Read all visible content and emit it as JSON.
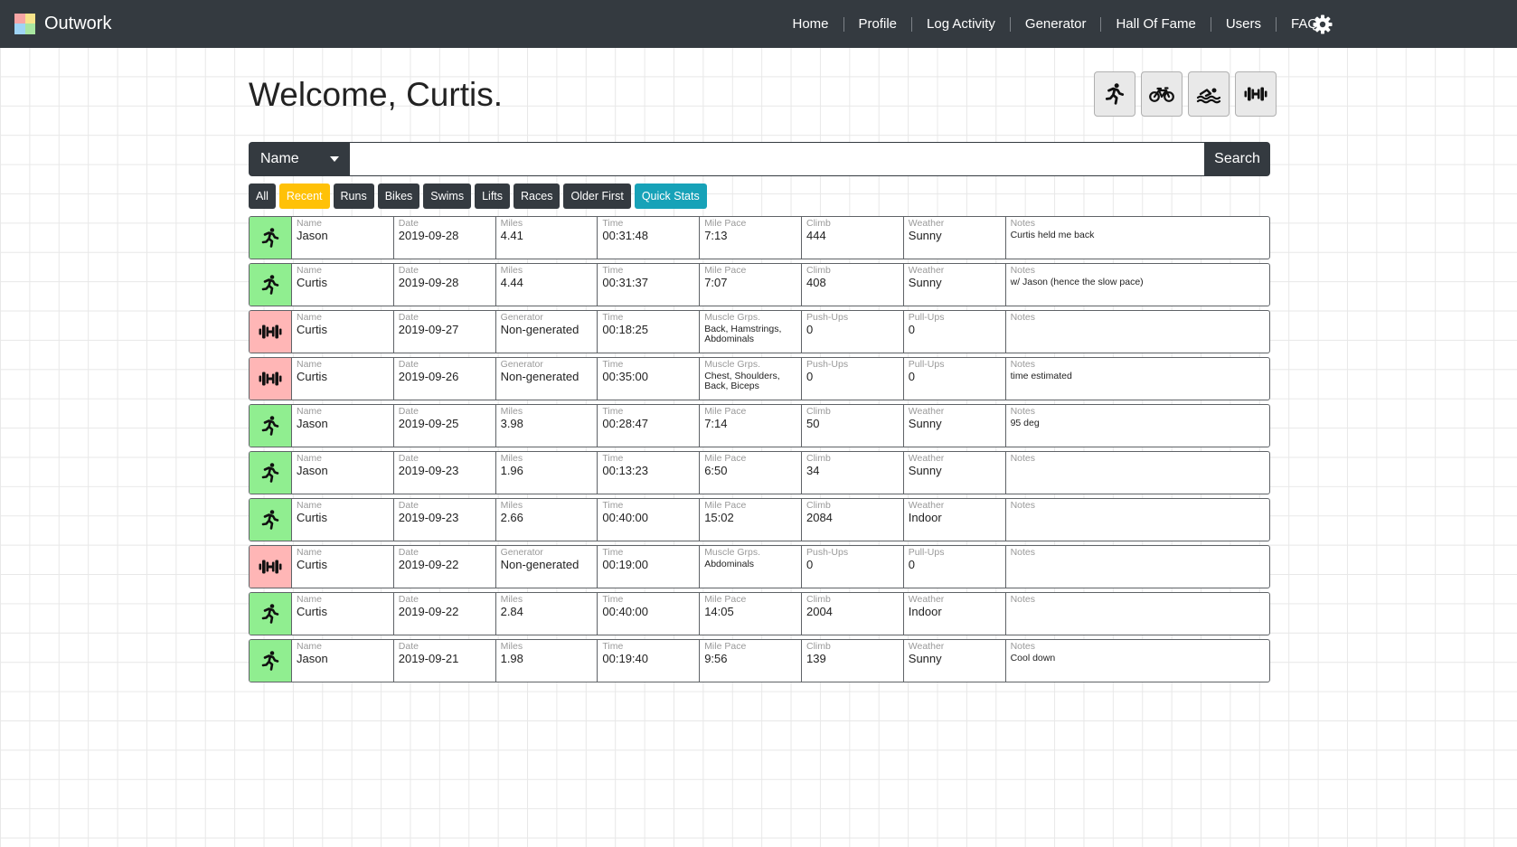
{
  "navbar": {
    "brand": "Outwork",
    "logo_colors": [
      "#f7a5a5",
      "#f7e38a",
      "#9fd4f5",
      "#a8e6a1"
    ],
    "links": [
      "Home",
      "Profile",
      "Log Activity",
      "Generator",
      "Hall Of Fame",
      "Users",
      "FAQ"
    ],
    "settings_icon": "gear-icon"
  },
  "welcome": "Welcome, Curtis.",
  "quick_actions": [
    "running-icon",
    "bike-icon",
    "swimming-icon",
    "dumbbell-icon"
  ],
  "search": {
    "dropdown_value": "Name",
    "input_value": "",
    "button": "Search"
  },
  "filters": [
    "All",
    "Recent",
    "Runs",
    "Bikes",
    "Swims",
    "Lifts",
    "Races",
    "Older First",
    "Quick Stats"
  ],
  "active_filter": "Recent",
  "colors": {
    "run": "#90ee90",
    "lift": "#ffb6b6",
    "dark": "#343a40",
    "recent": "#ffc107",
    "quick_stats": "#17a2b8"
  },
  "activities": [
    {
      "type": "run",
      "cells": [
        [
          "Name",
          "Jason"
        ],
        [
          "Date",
          "2019-09-28"
        ],
        [
          "Miles",
          "4.41"
        ],
        [
          "Time",
          "00:31:48"
        ],
        [
          "Mile Pace",
          "7:13"
        ],
        [
          "Climb",
          "444"
        ],
        [
          "Weather",
          "Sunny"
        ],
        [
          "Notes",
          "Curtis held me back"
        ]
      ]
    },
    {
      "type": "run",
      "cells": [
        [
          "Name",
          "Curtis"
        ],
        [
          "Date",
          "2019-09-28"
        ],
        [
          "Miles",
          "4.44"
        ],
        [
          "Time",
          "00:31:37"
        ],
        [
          "Mile Pace",
          "7:07"
        ],
        [
          "Climb",
          "408"
        ],
        [
          "Weather",
          "Sunny"
        ],
        [
          "Notes",
          "w/ Jason (hence the slow pace)"
        ]
      ]
    },
    {
      "type": "lift",
      "cells": [
        [
          "Name",
          "Curtis"
        ],
        [
          "Date",
          "2019-09-27"
        ],
        [
          "Generator",
          "Non-generated"
        ],
        [
          "Time",
          "00:18:25"
        ],
        [
          "Muscle Grps.",
          "Back, Hamstrings, Abdominals"
        ],
        [
          "Push-Ups",
          "0"
        ],
        [
          "Pull-Ups",
          "0"
        ],
        [
          "Notes",
          ""
        ]
      ]
    },
    {
      "type": "lift",
      "cells": [
        [
          "Name",
          "Curtis"
        ],
        [
          "Date",
          "2019-09-26"
        ],
        [
          "Generator",
          "Non-generated"
        ],
        [
          "Time",
          "00:35:00"
        ],
        [
          "Muscle Grps.",
          "Chest, Shoulders, Back, Biceps"
        ],
        [
          "Push-Ups",
          "0"
        ],
        [
          "Pull-Ups",
          "0"
        ],
        [
          "Notes",
          "time estimated"
        ]
      ]
    },
    {
      "type": "run",
      "cells": [
        [
          "Name",
          "Jason"
        ],
        [
          "Date",
          "2019-09-25"
        ],
        [
          "Miles",
          "3.98"
        ],
        [
          "Time",
          "00:28:47"
        ],
        [
          "Mile Pace",
          "7:14"
        ],
        [
          "Climb",
          "50"
        ],
        [
          "Weather",
          "Sunny"
        ],
        [
          "Notes",
          "95 deg"
        ]
      ]
    },
    {
      "type": "run",
      "cells": [
        [
          "Name",
          "Jason"
        ],
        [
          "Date",
          "2019-09-23"
        ],
        [
          "Miles",
          "1.96"
        ],
        [
          "Time",
          "00:13:23"
        ],
        [
          "Mile Pace",
          "6:50"
        ],
        [
          "Climb",
          "34"
        ],
        [
          "Weather",
          "Sunny"
        ],
        [
          "Notes",
          ""
        ]
      ]
    },
    {
      "type": "run",
      "cells": [
        [
          "Name",
          "Curtis"
        ],
        [
          "Date",
          "2019-09-23"
        ],
        [
          "Miles",
          "2.66"
        ],
        [
          "Time",
          "00:40:00"
        ],
        [
          "Mile Pace",
          "15:02"
        ],
        [
          "Climb",
          "2084"
        ],
        [
          "Weather",
          "Indoor"
        ],
        [
          "Notes",
          ""
        ]
      ]
    },
    {
      "type": "lift",
      "cells": [
        [
          "Name",
          "Curtis"
        ],
        [
          "Date",
          "2019-09-22"
        ],
        [
          "Generator",
          "Non-generated"
        ],
        [
          "Time",
          "00:19:00"
        ],
        [
          "Muscle Grps.",
          "Abdominals"
        ],
        [
          "Push-Ups",
          "0"
        ],
        [
          "Pull-Ups",
          "0"
        ],
        [
          "Notes",
          ""
        ]
      ]
    },
    {
      "type": "run",
      "cells": [
        [
          "Name",
          "Curtis"
        ],
        [
          "Date",
          "2019-09-22"
        ],
        [
          "Miles",
          "2.84"
        ],
        [
          "Time",
          "00:40:00"
        ],
        [
          "Mile Pace",
          "14:05"
        ],
        [
          "Climb",
          "2004"
        ],
        [
          "Weather",
          "Indoor"
        ],
        [
          "Notes",
          ""
        ]
      ]
    },
    {
      "type": "run",
      "cells": [
        [
          "Name",
          "Jason"
        ],
        [
          "Date",
          "2019-09-21"
        ],
        [
          "Miles",
          "1.98"
        ],
        [
          "Time",
          "00:19:40"
        ],
        [
          "Mile Pace",
          "9:56"
        ],
        [
          "Climb",
          "139"
        ],
        [
          "Weather",
          "Sunny"
        ],
        [
          "Notes",
          "Cool down"
        ]
      ]
    }
  ]
}
